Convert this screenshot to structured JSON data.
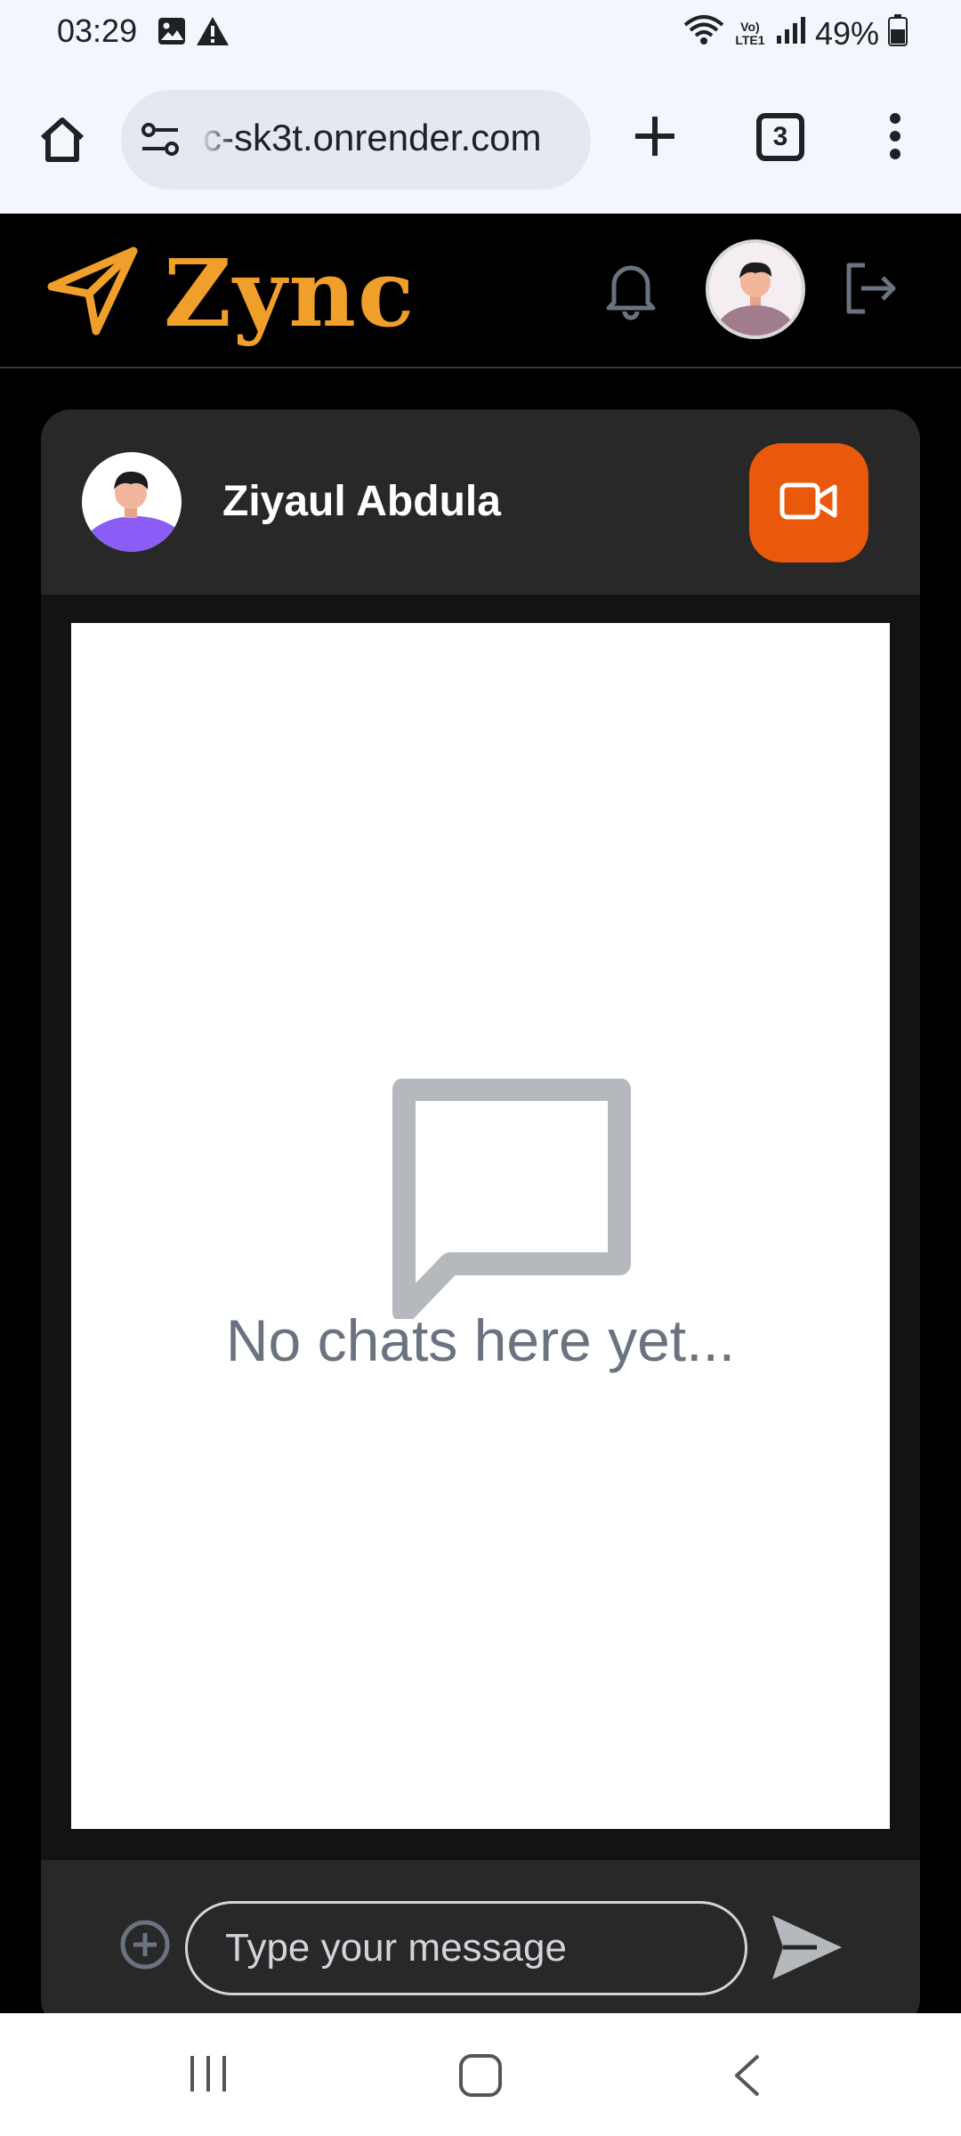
{
  "status_bar": {
    "time": "03:29",
    "network_label": "Vo) LTE1",
    "battery": "49%"
  },
  "browser": {
    "url": "c-sk3t.onrender.com",
    "tab_count": "3"
  },
  "app": {
    "brand": "Zync",
    "accent_color": "#f0a02a"
  },
  "chat": {
    "contact_name": "Ziyaul Abdula",
    "empty_message": "No chats here yet...",
    "input_placeholder": "Type your message",
    "video_button_color": "#ea580c"
  },
  "icons": {
    "status": [
      "image-icon",
      "warning-icon",
      "wifi-icon",
      "signal-icon",
      "battery-icon"
    ],
    "browser": [
      "home-icon",
      "site-settings-icon",
      "new-tab-icon",
      "tab-switcher-icon",
      "more-menu-icon"
    ],
    "app": [
      "paper-plane-logo-icon",
      "bell-icon",
      "logout-icon",
      "video-camera-icon",
      "chat-bubble-icon",
      "add-circle-icon",
      "send-icon"
    ],
    "nav": [
      "recents-icon",
      "home-nav-icon",
      "back-icon"
    ]
  }
}
